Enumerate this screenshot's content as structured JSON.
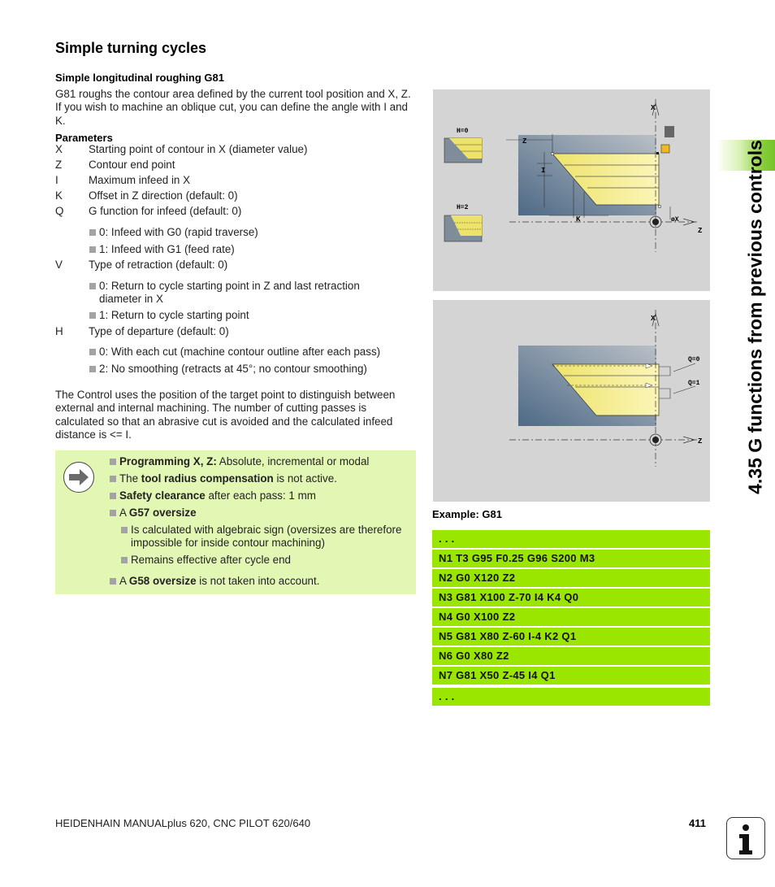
{
  "header": {
    "section_title": "Simple turning cycles",
    "subsection_title": "Simple longitudinal roughing G81"
  },
  "intro": "G81 roughs the contour area defined by the current tool position and X, Z. If you wish to machine an oblique cut, you can define the angle with I and K.",
  "parameters": {
    "title": "Parameters",
    "items": [
      {
        "key": "X",
        "desc": "Starting point of contour in X (diameter value)"
      },
      {
        "key": "Z",
        "desc": "Contour end point"
      },
      {
        "key": "I",
        "desc": "Maximum infeed in X"
      },
      {
        "key": "K",
        "desc": "Offset in Z direction (default: 0)"
      },
      {
        "key": "Q",
        "desc": "G function for infeed (default: 0)"
      },
      {
        "key": "V",
        "desc": "Type of retraction (default: 0)"
      },
      {
        "key": "H",
        "desc": "Type of departure (default: 0)"
      }
    ],
    "q_options": [
      "0: Infeed with G0 (rapid traverse)",
      "1: Infeed with G1 (feed rate)"
    ],
    "v_options": [
      "0: Return to cycle starting point in Z and last retraction diameter in X",
      "1: Return to cycle starting point"
    ],
    "h_options": [
      "0: With each cut (machine contour outline after each pass)",
      "2: No smoothing (retracts at 45°; no contour smoothing)"
    ]
  },
  "paragraph": "The Control uses the position of the target point to distinguish between external and internal machining. The number of cutting passes is calculated so that an abrasive cut is avoided and the calculated infeed distance is <= I.",
  "note": {
    "icon": "arrow-right-icon",
    "items": [
      {
        "bold": "Programming X, Z:",
        "pre": "",
        "post": " Absolute, incremental or modal"
      },
      {
        "pre": "The ",
        "bold": "tool radius compensation",
        "post": " is not active."
      },
      {
        "pre": "",
        "bold": "Safety clearance",
        "post": " after each pass: 1 mm"
      },
      {
        "pre": "A ",
        "bold": "G57 oversize",
        "post": ""
      },
      {
        "pre": "A ",
        "bold": "G58 oversize",
        "post": " is not taken into account."
      }
    ],
    "g57_sub": [
      "Is calculated with algebraic sign (oversizes are therefore impossible for inside contour machining)",
      "Remains effective after cycle end"
    ]
  },
  "figure1": {
    "labels": {
      "x_axis": "X",
      "z_axis": "Z",
      "z_dim": "Z",
      "i_dim": "I",
      "k_dim": "K",
      "dia_x": "øX",
      "h0": "H=0",
      "h2": "H=2"
    }
  },
  "figure2": {
    "labels": {
      "x_axis": "X",
      "z_axis": "Z",
      "q0": "Q=0",
      "q1": "Q=1"
    }
  },
  "example": {
    "title": "Example: G81",
    "lines": [
      ". . .",
      "N1 T3 G95 F0.25 G96 S200 M3",
      "N2 G0 X120 Z2",
      "N3 G81 X100 Z-70 I4 K4 Q0",
      "N4 G0 X100 Z2",
      "N5 G81 X80 Z-60 I-4 K2 Q1",
      "N6 G0 X80 Z2",
      "N7 G81 X50 Z-45 I4 Q1",
      ". . ."
    ]
  },
  "sidebar": {
    "chapter_title": "4.35 G functions from previous controls"
  },
  "footer": {
    "text": "HEIDENHAIN MANUALplus 620, CNC PILOT 620/640",
    "page": "411",
    "info_icon": "info-icon"
  },
  "colors": {
    "code_bg": "#9ae600",
    "note_bg": "#e3f7b4",
    "figure_bg": "#d4d4d4",
    "tab_green": "#78c22a"
  }
}
